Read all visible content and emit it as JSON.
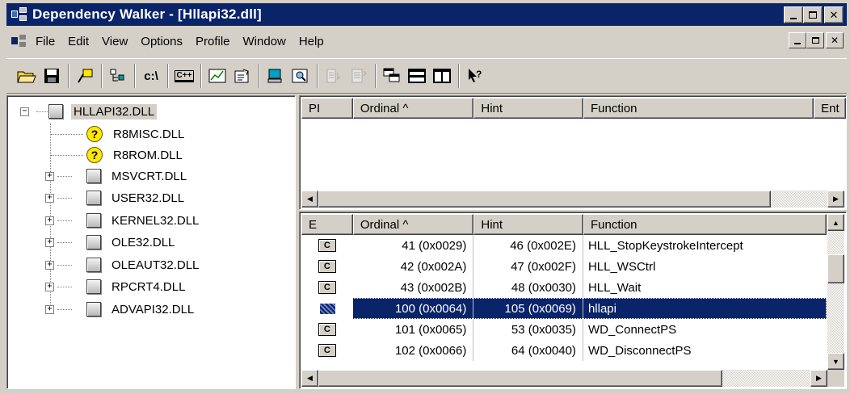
{
  "window": {
    "title": "Dependency Walker - [Hllapi32.dll]",
    "colors": {
      "titlebar": "#0a246a",
      "face": "#d4d0c8",
      "selection": "#0a246a"
    }
  },
  "menu": [
    "File",
    "Edit",
    "View",
    "Options",
    "Profile",
    "Window",
    "Help"
  ],
  "toolbar": {
    "c_path_label": "c:\\",
    "cpp_label": "C++"
  },
  "tree": {
    "root": "HLLAPI32.DLL",
    "children": [
      {
        "name": "R8MISC.DLL",
        "icon": "question-icon"
      },
      {
        "name": "R8ROM.DLL",
        "icon": "question-icon"
      },
      {
        "name": "MSVCRT.DLL",
        "icon": "module-icon"
      },
      {
        "name": "USER32.DLL",
        "icon": "module-icon"
      },
      {
        "name": "KERNEL32.DLL",
        "icon": "module-icon"
      },
      {
        "name": "OLE32.DLL",
        "icon": "module-icon"
      },
      {
        "name": "OLEAUT32.DLL",
        "icon": "module-icon"
      },
      {
        "name": "RPCRT4.DLL",
        "icon": "module-icon"
      },
      {
        "name": "ADVAPI32.DLL",
        "icon": "module-icon"
      }
    ]
  },
  "imports": {
    "columns": [
      "PI",
      "Ordinal ^",
      "Hint",
      "Function",
      "Ent"
    ]
  },
  "exports": {
    "columns": [
      "E",
      "Ordinal ^",
      "Hint",
      "Function"
    ],
    "rows": [
      {
        "icon_label": "C",
        "ordinal": "41 (0x0029)",
        "hint": "46 (0x002E)",
        "function": "HLL_StopKeystrokeIntercept",
        "selected": false
      },
      {
        "icon_label": "C",
        "ordinal": "42 (0x002A)",
        "hint": "47 (0x002F)",
        "function": "HLL_WSCtrl",
        "selected": false
      },
      {
        "icon_label": "C",
        "ordinal": "43 (0x002B)",
        "hint": "48 (0x0030)",
        "function": "HLL_Wait",
        "selected": false
      },
      {
        "icon_label": "C",
        "ordinal": "100 (0x0064)",
        "hint": "105 (0x0069)",
        "function": "hllapi",
        "selected": true
      },
      {
        "icon_label": "C",
        "ordinal": "101 (0x0065)",
        "hint": "53 (0x0035)",
        "function": "WD_ConnectPS",
        "selected": false
      },
      {
        "icon_label": "C",
        "ordinal": "102 (0x0066)",
        "hint": "64 (0x0040)",
        "function": "WD_DisconnectPS",
        "selected": false
      }
    ]
  }
}
